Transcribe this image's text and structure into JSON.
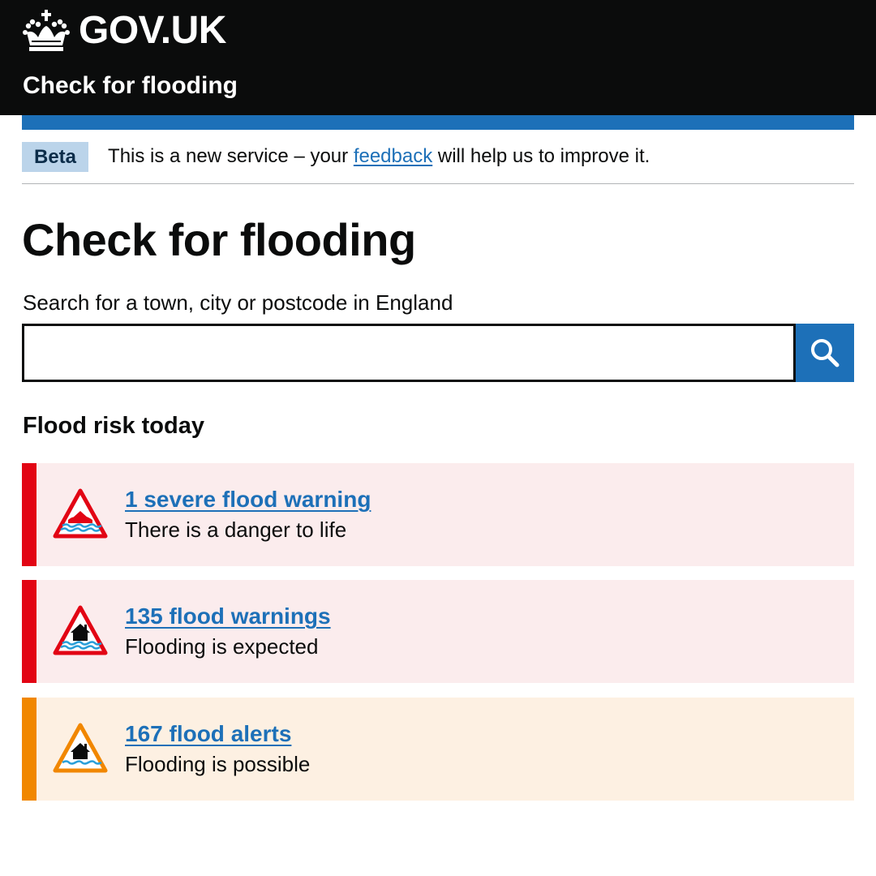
{
  "header": {
    "logo_text": "GOV.UK",
    "crown_icon": "crown-icon",
    "service_name": "Check for flooding",
    "background": "#0b0c0c"
  },
  "phase_banner": {
    "tag": "Beta",
    "text_before": "This is a new service – your ",
    "link_text": "feedback",
    "text_after": " will help us to improve it."
  },
  "main": {
    "title": "Check for flooding",
    "search": {
      "label": "Search for a town, city or postcode in England",
      "value": "",
      "placeholder": "",
      "button_icon": "search-icon"
    },
    "risk_heading": "Flood risk today",
    "alerts": [
      {
        "link": "1 severe flood warning",
        "description": "There is a danger to life",
        "icon": "severe-flood-warning-icon",
        "color": "#e20514"
      },
      {
        "link": "135 flood warnings",
        "description": "Flooding is expected",
        "icon": "flood-warning-icon",
        "color": "#e20514"
      },
      {
        "link": "167 flood alerts",
        "description": "Flooding is possible",
        "icon": "flood-alert-icon",
        "color": "#f18700"
      }
    ]
  },
  "colors": {
    "link": "#1d70b8",
    "brand_blue": "#1d70b8",
    "severe_red": "#e20514",
    "alert_orange": "#f18700",
    "red_panel": "#fbeced",
    "orange_panel": "#fdf0e2"
  }
}
